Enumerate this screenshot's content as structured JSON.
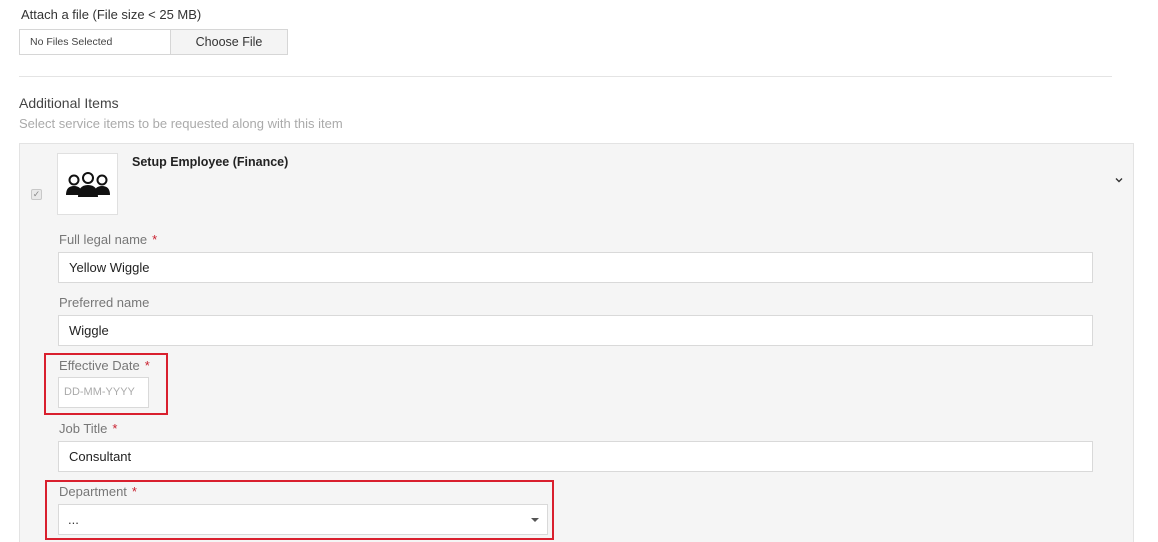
{
  "attachment": {
    "label": "Attach a file (File size < 25 MB)",
    "status": "No Files Selected",
    "button_label": "Choose File"
  },
  "additional_items": {
    "title": "Additional Items",
    "subtitle": "Select service items to be requested along with this item"
  },
  "item": {
    "checked": true,
    "title": "Setup Employee (Finance)",
    "icon": "people-group-icon",
    "expand_icon": "chevron-down-icon"
  },
  "form": {
    "full_legal_name": {
      "label": "Full legal name",
      "required_mark": "*",
      "value": "Yellow Wiggle"
    },
    "preferred_name": {
      "label": "Preferred name",
      "value": "Wiggle"
    },
    "effective_date": {
      "label": "Effective Date",
      "required_mark": "*",
      "placeholder": "DD-MM-YYYY"
    },
    "job_title": {
      "label": "Job Title",
      "required_mark": "*",
      "value": "Consultant"
    },
    "department": {
      "label": "Department",
      "required_mark": "*",
      "selected": "..."
    }
  },
  "colors": {
    "required": "#c9202f",
    "highlight_border": "#d9202e",
    "panel_background": "#f5f5f5"
  }
}
